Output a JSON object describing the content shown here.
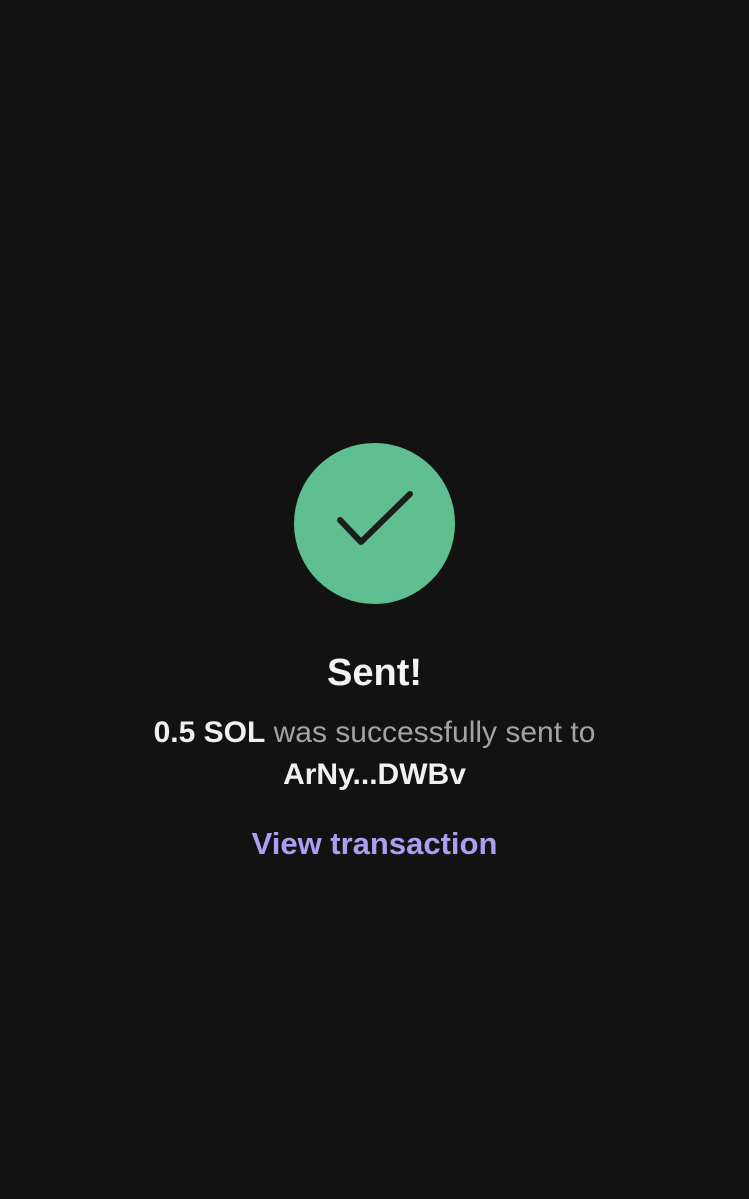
{
  "status": {
    "icon": "checkmark-icon",
    "icon_color": "#5fbf90",
    "title": "Sent!"
  },
  "message": {
    "amount": "0.5 SOL",
    "text": " was successfully sent to",
    "recipient": "ArNy...DWBv"
  },
  "link": {
    "label": "View transaction",
    "color": "#ab9ff2"
  },
  "colors": {
    "background": "#121212",
    "primary_text": "#f0f0f0",
    "secondary_text": "#a3a3a3"
  }
}
